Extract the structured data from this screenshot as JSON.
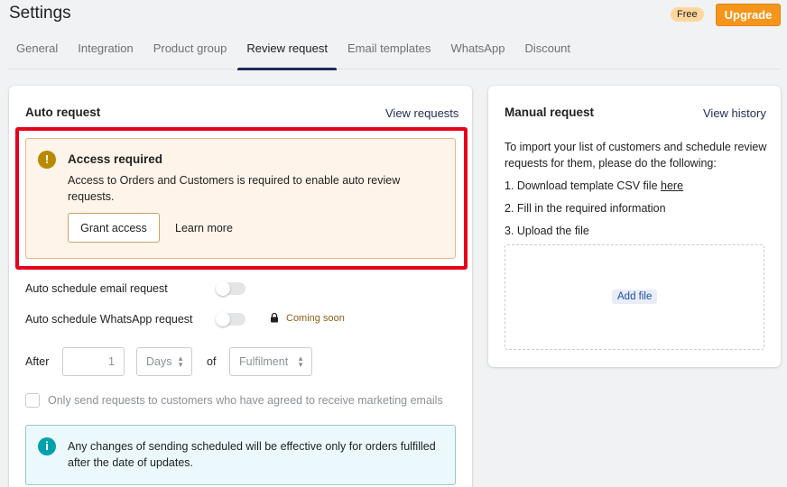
{
  "header": {
    "title": "Settings",
    "plan_badge": "Free",
    "upgrade_label": "Upgrade"
  },
  "tabs": [
    {
      "label": "General"
    },
    {
      "label": "Integration"
    },
    {
      "label": "Product group"
    },
    {
      "label": "Review request",
      "active": true
    },
    {
      "label": "Email templates"
    },
    {
      "label": "WhatsApp"
    },
    {
      "label": "Discount"
    }
  ],
  "auto_request": {
    "heading": "Auto request",
    "view_link": "View requests",
    "access_banner": {
      "title": "Access required",
      "body": "Access to Orders and Customers is required to enable auto review requests.",
      "grant_label": "Grant access",
      "learn_more_label": "Learn more"
    },
    "email_toggle_label": "Auto schedule email request",
    "whatsapp_toggle_label": "Auto schedule WhatsApp request",
    "coming_soon": "Coming soon",
    "after_label": "After",
    "after_value": "1",
    "unit_select": "Days",
    "of_label": "of",
    "event_select": "Fulfilment",
    "marketing_checkbox_label": "Only send requests to customers who have agreed to receive marketing emails",
    "info_banner": "Any changes of sending scheduled will be effective only for orders fulfilled after the date of updates."
  },
  "manual_request": {
    "heading": "Manual request",
    "view_link": "View history",
    "intro": "To import your list of customers and schedule review requests for them, please do the following:",
    "step1_text": "1. Download template CSV file ",
    "step1_link": "here",
    "step2": "2. Fill in the required information",
    "step3": "3. Upload the file",
    "add_file_label": "Add file"
  },
  "colors": {
    "accent": "#f5951b",
    "highlight": "#e5001b",
    "warning_bg": "#fff4e9",
    "info_bg": "#ebf9fc"
  }
}
